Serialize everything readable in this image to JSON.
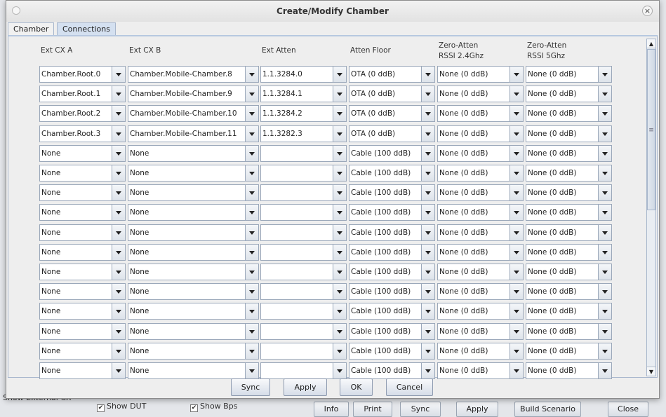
{
  "background": {
    "show_external_cx": "Show External CX",
    "show_dut": "Show DUT",
    "show_bps": "Show Bps",
    "buttons": [
      "Info",
      "Print",
      "Sync",
      "Apply",
      "Build Scenario",
      "Close"
    ]
  },
  "dialog": {
    "title": "Create/Modify Chamber",
    "tabs": [
      {
        "label": "Chamber",
        "active": false
      },
      {
        "label": "Connections",
        "active": true
      }
    ],
    "columns": [
      "Ext CX A",
      "Ext CX B",
      "Ext Atten",
      "Atten Floor",
      "Zero-Atten\nRSSI 2.4Ghz",
      "Zero-Atten\nRSSI 5Ghz"
    ],
    "rows": [
      [
        "Chamber.Root.0",
        "Chamber.Mobile-Chamber.8",
        "1.1.3284.0",
        "OTA (0 ddB)",
        "None (0 ddB)",
        "None (0 ddB)"
      ],
      [
        "Chamber.Root.1",
        "Chamber.Mobile-Chamber.9",
        "1.1.3284.1",
        "OTA (0 ddB)",
        "None (0 ddB)",
        "None (0 ddB)"
      ],
      [
        "Chamber.Root.2",
        "Chamber.Mobile-Chamber.10",
        "1.1.3284.2",
        "OTA (0 ddB)",
        "None (0 ddB)",
        "None (0 ddB)"
      ],
      [
        "Chamber.Root.3",
        "Chamber.Mobile-Chamber.11",
        "1.1.3282.3",
        "OTA (0 ddB)",
        "None (0 ddB)",
        "None (0 ddB)"
      ],
      [
        "None",
        "None",
        "",
        "Cable (100 ddB)",
        "None (0 ddB)",
        "None (0 ddB)"
      ],
      [
        "None",
        "None",
        "",
        "Cable (100 ddB)",
        "None (0 ddB)",
        "None (0 ddB)"
      ],
      [
        "None",
        "None",
        "",
        "Cable (100 ddB)",
        "None (0 ddB)",
        "None (0 ddB)"
      ],
      [
        "None",
        "None",
        "",
        "Cable (100 ddB)",
        "None (0 ddB)",
        "None (0 ddB)"
      ],
      [
        "None",
        "None",
        "",
        "Cable (100 ddB)",
        "None (0 ddB)",
        "None (0 ddB)"
      ],
      [
        "None",
        "None",
        "",
        "Cable (100 ddB)",
        "None (0 ddB)",
        "None (0 ddB)"
      ],
      [
        "None",
        "None",
        "",
        "Cable (100 ddB)",
        "None (0 ddB)",
        "None (0 ddB)"
      ],
      [
        "None",
        "None",
        "",
        "Cable (100 ddB)",
        "None (0 ddB)",
        "None (0 ddB)"
      ],
      [
        "None",
        "None",
        "",
        "Cable (100 ddB)",
        "None (0 ddB)",
        "None (0 ddB)"
      ],
      [
        "None",
        "None",
        "",
        "Cable (100 ddB)",
        "None (0 ddB)",
        "None (0 ddB)"
      ],
      [
        "None",
        "None",
        "",
        "Cable (100 ddB)",
        "None (0 ddB)",
        "None (0 ddB)"
      ],
      [
        "None",
        "None",
        "",
        "Cable (100 ddB)",
        "None (0 ddB)",
        "None (0 ddB)"
      ]
    ],
    "buttons": {
      "sync": "Sync",
      "apply": "Apply",
      "ok": "OK",
      "cancel": "Cancel"
    }
  }
}
